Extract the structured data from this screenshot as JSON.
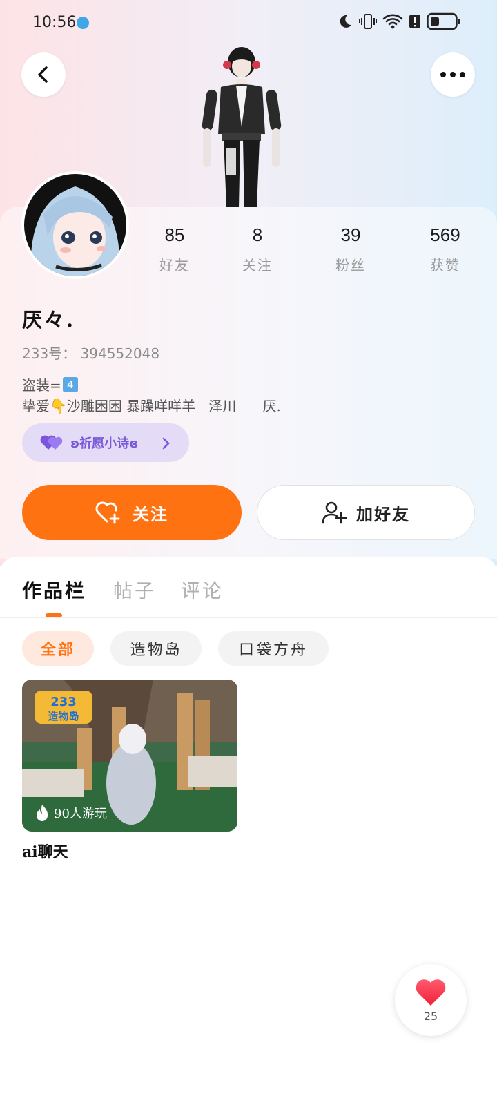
{
  "status_bar": {
    "time": "10:56",
    "icons": [
      "moon-icon",
      "vibrate-icon",
      "wifi-icon",
      "alert-icon",
      "battery-icon"
    ]
  },
  "header": {
    "back_icon": "chevron-left-icon",
    "more_icon": "more-horizontal-icon"
  },
  "profile": {
    "stats": [
      {
        "value": "85",
        "label": "好友"
      },
      {
        "value": "8",
        "label": "关注"
      },
      {
        "value": "39",
        "label": "粉丝"
      },
      {
        "value": "569",
        "label": "获赞"
      }
    ],
    "nickname": "厌々.",
    "uid": "233号： 394552048",
    "bio_line1": "盗装=",
    "bio_line1_emoji": "4",
    "bio_line2": "挚爱👇沙雕困困 暴躁咩咩羊   泽川      厌.",
    "tag_label": "ʚ祈愿小诗ɞ"
  },
  "actions": {
    "follow_label": "关注",
    "add_friend_label": "加好友",
    "accent_color": "#fe7212"
  },
  "tabs": [
    {
      "label": "作品栏",
      "active": true
    },
    {
      "label": "帖子",
      "active": false
    },
    {
      "label": "评论",
      "active": false
    }
  ],
  "filters": [
    {
      "label": "全部",
      "active": true
    },
    {
      "label": "造物岛",
      "active": false
    },
    {
      "label": "口袋方舟",
      "active": false
    }
  ],
  "works": [
    {
      "badge": "233 造物岛",
      "plays": "90人游玩",
      "title": "ai聊天"
    }
  ],
  "like_fab": {
    "count": "25"
  }
}
